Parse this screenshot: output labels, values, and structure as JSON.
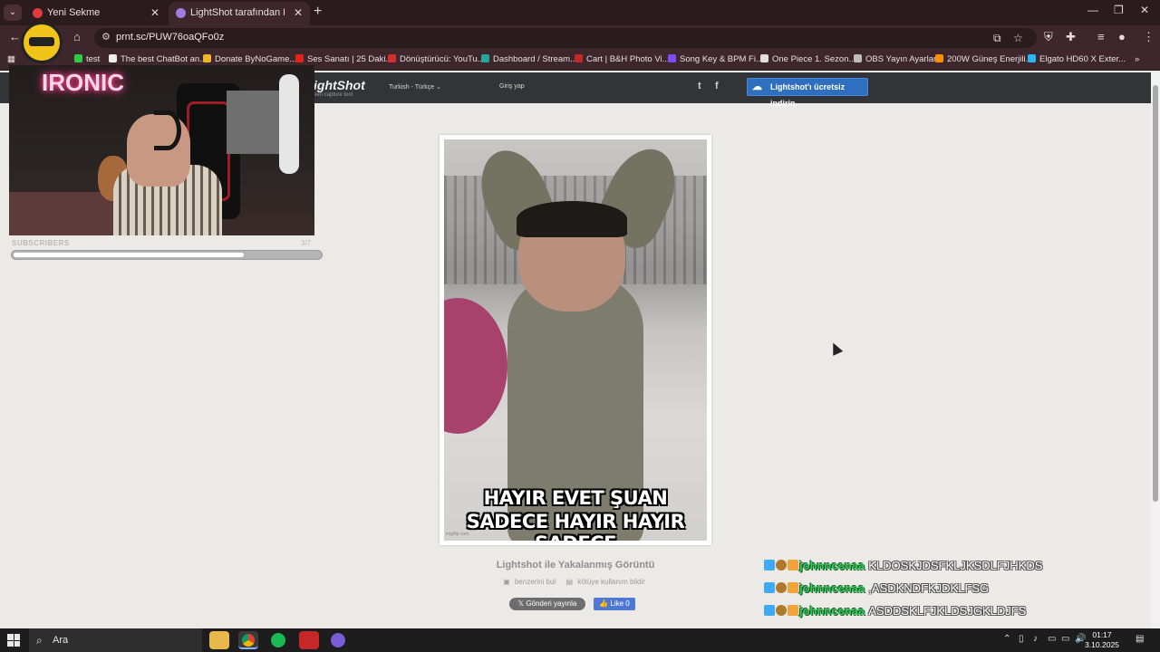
{
  "browser": {
    "tabs": [
      {
        "label": "Yeni Sekme",
        "active": false
      },
      {
        "label": "LightShot tarafından Ekran Görü",
        "active": true
      }
    ],
    "new_tab": "+",
    "url": "prnt.sc/PUW76oaQFo0z",
    "bookmarks": [
      {
        "label": "test",
        "color": "#2ecc40"
      },
      {
        "label": "The best ChatBot an...",
        "color": "#eeeeee"
      },
      {
        "label": "Donate ByNoGame...",
        "color": "#f0b429"
      },
      {
        "label": "Ses Sanatı | 25 Daki...",
        "color": "#e62117"
      },
      {
        "label": "Dönüştürücü: YouTu...",
        "color": "#d32f2f"
      },
      {
        "label": "Dashboard / Stream...",
        "color": "#26a69a"
      },
      {
        "label": "Cart | B&H Photo Vi...",
        "color": "#c62828"
      },
      {
        "label": "Song Key & BPM Fi...",
        "color": "#7c4dff"
      },
      {
        "label": "One Piece 1. Sezon...",
        "color": "#e0e0e0"
      },
      {
        "label": "OBS Yayın Ayarları",
        "color": "#bdbdbd"
      },
      {
        "label": "200W Güneş Enerjili...",
        "color": "#ff8f00"
      },
      {
        "label": "Elgato HD60 X Exter...",
        "color": "#29b6f6"
      }
    ]
  },
  "lightshot": {
    "logo": "ightShot",
    "tagline": "een capture tool",
    "language": "Turkish - Türkçe",
    "login": "Giriş yap",
    "download_label": "Lightshot'ı ücretsiz indirin",
    "twitter_icon": "t",
    "facebook_icon": "f",
    "image_caption_line1": "HAYIR EVET ŞUAN",
    "image_caption_line2": "SADECE HAYIR HAYIR SADECE",
    "image_watermark": "imgflip.com",
    "title": "Lightshot ile Yakalanmış Görüntü",
    "link_similar": "benzerini bul",
    "link_report": "kötüye kullanım bildir",
    "tweet_label": "Gönderi yayınla",
    "like_label": "Like 0"
  },
  "overlay": {
    "neon_sign": "IRONIC",
    "subscribers_label": "SUBSCRIBERS",
    "subscribers_count": "3/7",
    "subscribers_progress": 0.75
  },
  "chat": [
    {
      "user": "johnncenaa",
      "message": "KLDOSKJDSFKLJKSDLFJHKDS"
    },
    {
      "user": "johnncenaa",
      "message": ",ASDKNDFKJDKLFSG"
    },
    {
      "user": "johnncenaa",
      "message": "ASDDSKLFJKLDSJGKLDJFS"
    }
  ],
  "taskbar": {
    "search_placeholder": "Ara",
    "time": "01:17",
    "date": "3.10.2025"
  }
}
